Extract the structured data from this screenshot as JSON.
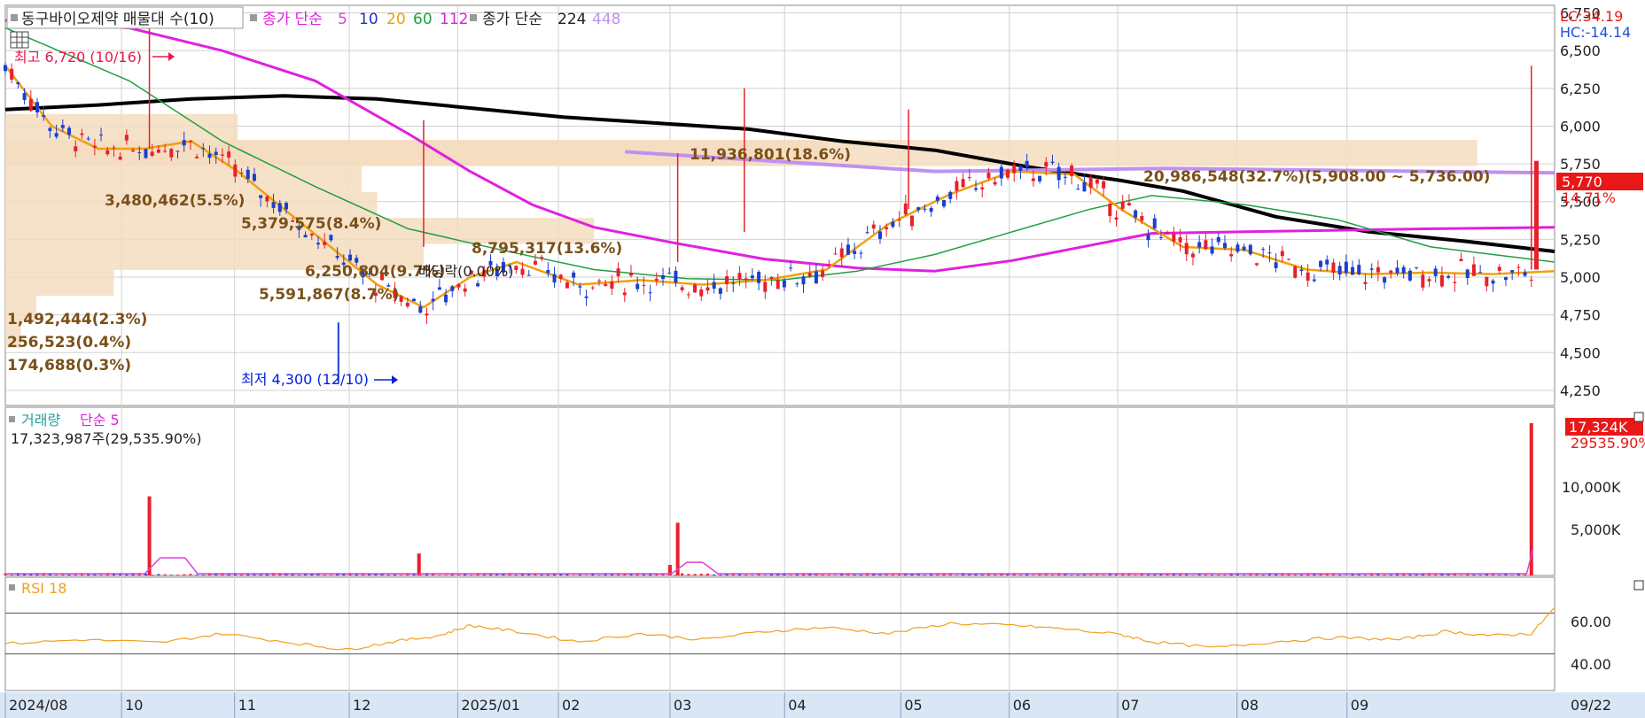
{
  "colors": {
    "up": "#e8202a",
    "down": "#1a3fd0",
    "ma5": "#e040e0",
    "ma10": "#2030c0",
    "ma20": "#f0a010",
    "ma60": "#20a040",
    "ma112": "#e020e0",
    "ma224": "#000000",
    "ma448": "#c090f0",
    "rsi": "#f0a020",
    "vol_ma": "#e040e0",
    "profile_fill": "#f5dcc0",
    "grid": "#d0d0d0",
    "axis_bg": "#d9e6f6",
    "price_tag": "#e81818",
    "high_label": "#e81850",
    "low_label": "#0020e0",
    "profile_text": "#7a5018",
    "rsi_title": "#f0a020",
    "vol_title": "#20a0a0",
    "vol_ma_title": "#e020e0",
    "lc_color": "#e81818",
    "hc_color": "#2050e0"
  },
  "legend": {
    "stock_name": "동구바이오제약 매물대 수(10)",
    "ma_group1_prefix": "종가 단순",
    "ma_group1": [
      "5",
      "10",
      "20",
      "60",
      "112"
    ],
    "ma_group2_prefix": "종가 단순",
    "ma_group2": [
      "224",
      "448"
    ]
  },
  "right_info": {
    "lc": "LC:34.19",
    "hc": "HC:-14.14",
    "price_tag": "5,770",
    "change_pct": "14.71%"
  },
  "annotations": {
    "high_label": "최고 6,720 (10/16)",
    "low_label": "최저 4,300 (12/10)",
    "ex_rights": "배당락(0.00%)"
  },
  "volume_panel": {
    "title": "거래량",
    "ma_label": "단순 5",
    "summary": "17,323,987주(29,535.90%)",
    "tag_value": "17,324K",
    "tag_pct": "29535.90%",
    "y_ticks": [
      "10,000K",
      "5,000K"
    ]
  },
  "rsi_panel": {
    "title": "RSI 18",
    "y_ticks": [
      "60.00",
      "40.00"
    ]
  },
  "x_axis": {
    "labels": [
      "2024/08",
      "10",
      "11",
      "12",
      "2025/01",
      "02",
      "03",
      "04",
      "05",
      "06",
      "07",
      "08",
      "09"
    ],
    "last_date": "09/22"
  },
  "chart_data": [
    {
      "type": "candlestick",
      "title": "",
      "y_ticks": [
        "6,750",
        "6,500",
        "6,250",
        "6,000",
        "5,750",
        "5,500",
        "5,250",
        "5,000",
        "4,750",
        "4,500",
        "4,250"
      ],
      "ylim": [
        4150,
        6800
      ],
      "x": [
        "2024/08",
        "10",
        "11",
        "12",
        "2025/01",
        "02",
        "03",
        "04",
        "05",
        "06",
        "07",
        "08",
        "09"
      ],
      "last_close": 5770,
      "high": {
        "value": 6720,
        "date": "10/16"
      },
      "low": {
        "value": 4300,
        "date": "12/10"
      },
      "volume_profile": [
        {
          "label": "11,936,801(18.6%)",
          "low": 5736,
          "high": 5908,
          "length": 0.53
        },
        {
          "label": "20,986,548(32.7%)(5,908.00 ~ 5,736.00)",
          "low": 5736,
          "high": 5908,
          "length": 0.95
        },
        {
          "label": "3,480,462(5.5%)",
          "low": 5908,
          "high": 6080,
          "length": 0.15
        },
        {
          "label": "5,379,575(8.4%)",
          "low": 5564,
          "high": 5736,
          "length": 0.23
        },
        {
          "label": "8,795,317(13.6%)",
          "low": 5220,
          "high": 5392,
          "length": 0.38
        },
        {
          "label": "6,250,804(9.7%)",
          "low": 5048,
          "high": 5220,
          "length": 0.27
        },
        {
          "label": "5,591,867(8.7%)",
          "low": 5392,
          "high": 5564,
          "length": 0.24
        },
        {
          "label": "1,492,444(2.3%)",
          "low": 4876,
          "high": 5048,
          "length": 0.07
        },
        {
          "label": "256,523(0.4%)",
          "low": 4704,
          "high": 4876,
          "length": 0.02
        },
        {
          "label": "174,688(0.3%)",
          "low": 4532,
          "high": 4704,
          "length": 0.01
        }
      ],
      "series": [
        {
          "name": "224",
          "values": [
            [
              0,
              6110
            ],
            [
              0.06,
              6140
            ],
            [
              0.12,
              6180
            ],
            [
              0.18,
              6200
            ],
            [
              0.24,
              6180
            ],
            [
              0.3,
              6120
            ],
            [
              0.36,
              6060
            ],
            [
              0.42,
              6020
            ],
            [
              0.48,
              5980
            ],
            [
              0.54,
              5900
            ],
            [
              0.6,
              5840
            ],
            [
              0.66,
              5730
            ],
            [
              0.72,
              5640
            ],
            [
              0.76,
              5570
            ],
            [
              0.82,
              5400
            ],
            [
              0.88,
              5300
            ],
            [
              0.94,
              5240
            ],
            [
              1,
              5170
            ]
          ]
        },
        {
          "name": "112",
          "values": [
            [
              0,
              6700
            ],
            [
              0.08,
              6650
            ],
            [
              0.14,
              6500
            ],
            [
              0.2,
              6300
            ],
            [
              0.26,
              5950
            ],
            [
              0.3,
              5700
            ],
            [
              0.34,
              5480
            ],
            [
              0.38,
              5330
            ],
            [
              0.43,
              5230
            ],
            [
              0.49,
              5120
            ],
            [
              0.55,
              5060
            ],
            [
              0.6,
              5040
            ],
            [
              0.65,
              5110
            ],
            [
              0.7,
              5210
            ],
            [
              0.74,
              5290
            ],
            [
              0.8,
              5300
            ],
            [
              0.86,
              5310
            ],
            [
              0.92,
              5320
            ],
            [
              1,
              5330
            ]
          ]
        },
        {
          "name": "448",
          "values": [
            [
              0.4,
              5830
            ],
            [
              0.6,
              5700
            ],
            [
              0.75,
              5720
            ],
            [
              1,
              5690
            ]
          ]
        },
        {
          "name": "60",
          "values": [
            [
              0,
              6650
            ],
            [
              0.08,
              6300
            ],
            [
              0.14,
              5900
            ],
            [
              0.2,
              5600
            ],
            [
              0.26,
              5320
            ],
            [
              0.32,
              5180
            ],
            [
              0.38,
              5050
            ],
            [
              0.44,
              4990
            ],
            [
              0.5,
              4980
            ],
            [
              0.55,
              5040
            ],
            [
              0.6,
              5150
            ],
            [
              0.65,
              5300
            ],
            [
              0.7,
              5450
            ],
            [
              0.74,
              5540
            ],
            [
              0.8,
              5480
            ],
            [
              0.86,
              5380
            ],
            [
              0.92,
              5200
            ],
            [
              1,
              5100
            ]
          ]
        },
        {
          "name": "20",
          "values": [
            [
              0,
              6400
            ],
            [
              0.03,
              6000
            ],
            [
              0.06,
              5850
            ],
            [
              0.09,
              5850
            ],
            [
              0.12,
              5900
            ],
            [
              0.15,
              5700
            ],
            [
              0.18,
              5450
            ],
            [
              0.21,
              5200
            ],
            [
              0.24,
              4950
            ],
            [
              0.27,
              4800
            ],
            [
              0.3,
              5000
            ],
            [
              0.33,
              5100
            ],
            [
              0.37,
              4950
            ],
            [
              0.41,
              4980
            ],
            [
              0.45,
              4950
            ],
            [
              0.49,
              4980
            ],
            [
              0.53,
              5050
            ],
            [
              0.57,
              5350
            ],
            [
              0.61,
              5550
            ],
            [
              0.65,
              5700
            ],
            [
              0.69,
              5680
            ],
            [
              0.72,
              5450
            ],
            [
              0.76,
              5200
            ],
            [
              0.8,
              5180
            ],
            [
              0.84,
              5050
            ],
            [
              0.88,
              5020
            ],
            [
              0.92,
              5030
            ],
            [
              0.96,
              5020
            ],
            [
              1,
              5040
            ]
          ]
        },
        {
          "name": "RSI 18",
          "values": [
            [
              0,
              40
            ],
            [
              0.05,
              44
            ],
            [
              0.1,
              41
            ],
            [
              0.14,
              50
            ],
            [
              0.19,
              40
            ],
            [
              0.22,
              34
            ],
            [
              0.25,
              42
            ],
            [
              0.28,
              48
            ],
            [
              0.3,
              58
            ],
            [
              0.33,
              52
            ],
            [
              0.37,
              42
            ],
            [
              0.41,
              50
            ],
            [
              0.45,
              44
            ],
            [
              0.49,
              52
            ],
            [
              0.53,
              56
            ],
            [
              0.57,
              50
            ],
            [
              0.61,
              60
            ],
            [
              0.65,
              58
            ],
            [
              0.68,
              55
            ],
            [
              0.72,
              49
            ],
            [
              0.74,
              42
            ],
            [
              0.78,
              36
            ],
            [
              0.82,
              42
            ],
            [
              0.86,
              46
            ],
            [
              0.9,
              44
            ],
            [
              0.93,
              52
            ],
            [
              0.96,
              48
            ],
            [
              0.985,
              50
            ],
            [
              1,
              75
            ]
          ]
        }
      ]
    }
  ]
}
